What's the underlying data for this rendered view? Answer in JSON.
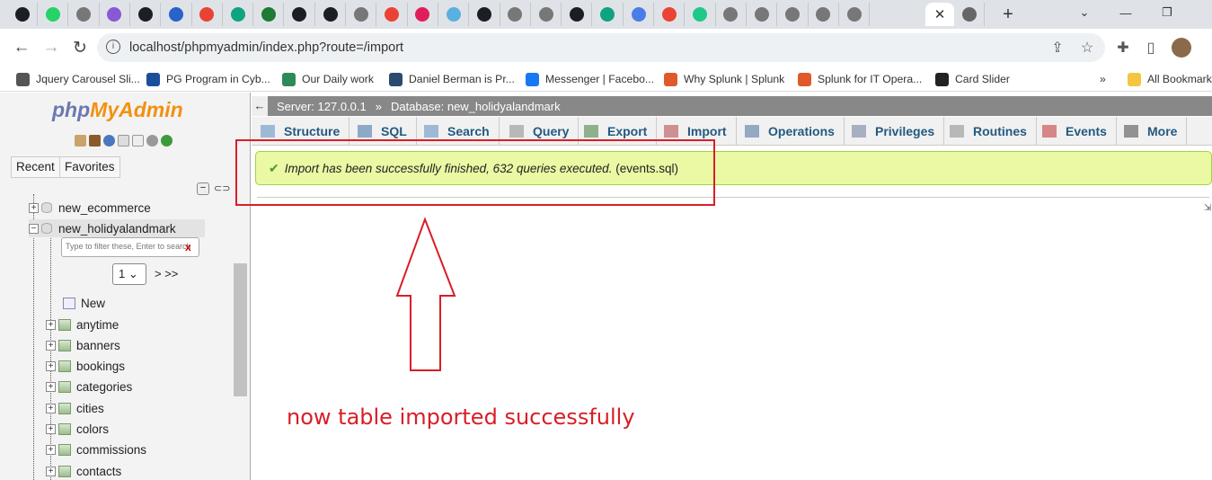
{
  "browser": {
    "tab_icons": [
      "github-icon",
      "whatsapp-icon",
      "chrome-icon",
      "vimeo-icon",
      "github-icon",
      "generic-icon",
      "gmail-icon",
      "chatgpt-icon",
      "w-icon",
      "github-icon",
      "github-icon",
      "chrome-icon",
      "gmail-icon",
      "slack-icon",
      "bulb-icon",
      "github-icon",
      "chrome-icon",
      "chrome-icon",
      "github-icon",
      "chatgpt-icon",
      "gemini-icon",
      "gmail-icon",
      "m-icon",
      "chrome-icon",
      "chrome-icon",
      "chrome-icon",
      "chrome-icon",
      "chrome-icon"
    ],
    "active_tab_close": "✕",
    "new_tab": "+",
    "url": "localhost/phpmyadmin/index.php?route=/import",
    "bookmarks": [
      {
        "label": "Jquery Carousel Sli...",
        "color": "#555555"
      },
      {
        "label": "PG Program in Cyb...",
        "color": "#1b4f9c"
      },
      {
        "label": "Our Daily work",
        "color": "#2e8b57"
      },
      {
        "label": "Daniel Berman is Pr...",
        "color": "#2b4a6f"
      },
      {
        "label": "Messenger | Facebo...",
        "color": "#1877f2"
      },
      {
        "label": "Why Splunk | Splunk",
        "color": "#e0592a"
      },
      {
        "label": "Splunk for IT Opera...",
        "color": "#e0592a"
      },
      {
        "label": "Card Slider",
        "color": "#222222"
      }
    ],
    "bookmarks_overflow": "»",
    "all_bookmarks": "All Bookmarks"
  },
  "sidebar": {
    "logo_php": "php",
    "logo_myadmin": "MyAdmin",
    "recent_label": "Recent",
    "favorites_label": "Favorites",
    "databases": [
      "new_ecommerce",
      "new_holidyalandmark"
    ],
    "filter_placeholder": "Type to filter these, Enter to search",
    "filter_clear": "x",
    "page_value": "1",
    "page_nav": "> >>",
    "new_label": "New",
    "tables": [
      "anytime",
      "banners",
      "bookings",
      "categories",
      "cities",
      "colors",
      "commissions",
      "contacts"
    ]
  },
  "main": {
    "breadcrumb_server": "Server: 127.0.0.1",
    "breadcrumb_sep": "»",
    "breadcrumb_db": "Database: new_holidyalandmark",
    "tabs": [
      "Structure",
      "SQL",
      "Search",
      "Query",
      "Export",
      "Import",
      "Operations",
      "Privileges",
      "Routines",
      "Events",
      "More"
    ],
    "success_message": "Import has been successfully finished, 632 queries executed.",
    "success_file": "(events.sql)"
  },
  "annotation": {
    "caption": "now table imported successfully",
    "color": "#d81e27"
  }
}
